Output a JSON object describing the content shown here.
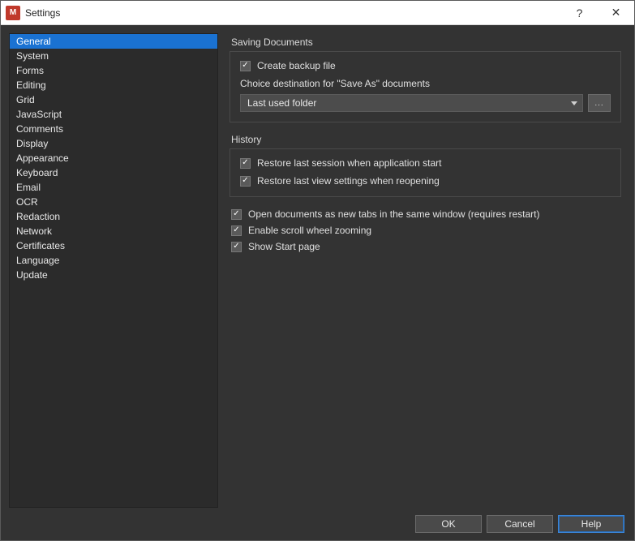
{
  "window": {
    "title": "Settings",
    "app_icon_letter": "M"
  },
  "sidebar": {
    "items": [
      {
        "label": "General",
        "selected": true
      },
      {
        "label": "System"
      },
      {
        "label": "Forms"
      },
      {
        "label": "Editing"
      },
      {
        "label": "Grid"
      },
      {
        "label": "JavaScript"
      },
      {
        "label": "Comments"
      },
      {
        "label": "Display"
      },
      {
        "label": "Appearance"
      },
      {
        "label": "Keyboard"
      },
      {
        "label": "Email"
      },
      {
        "label": "OCR"
      },
      {
        "label": "Redaction"
      },
      {
        "label": "Network"
      },
      {
        "label": "Certificates"
      },
      {
        "label": "Language"
      },
      {
        "label": "Update"
      }
    ]
  },
  "main": {
    "saving": {
      "title": "Saving Documents",
      "create_backup": "Create backup file",
      "choice_dest_label": "Choice destination for \"Save As\" documents",
      "dropdown_value": "Last used folder",
      "browse_label": "..."
    },
    "history": {
      "title": "History",
      "restore_session": "Restore last session when application start",
      "restore_view": "Restore last view settings when reopening"
    },
    "general": {
      "open_as_tabs": "Open documents as new tabs in the same window (requires restart)",
      "scroll_zoom": "Enable scroll wheel zooming",
      "start_page": "Show Start page"
    }
  },
  "footer": {
    "ok": "OK",
    "cancel": "Cancel",
    "help": "Help"
  }
}
